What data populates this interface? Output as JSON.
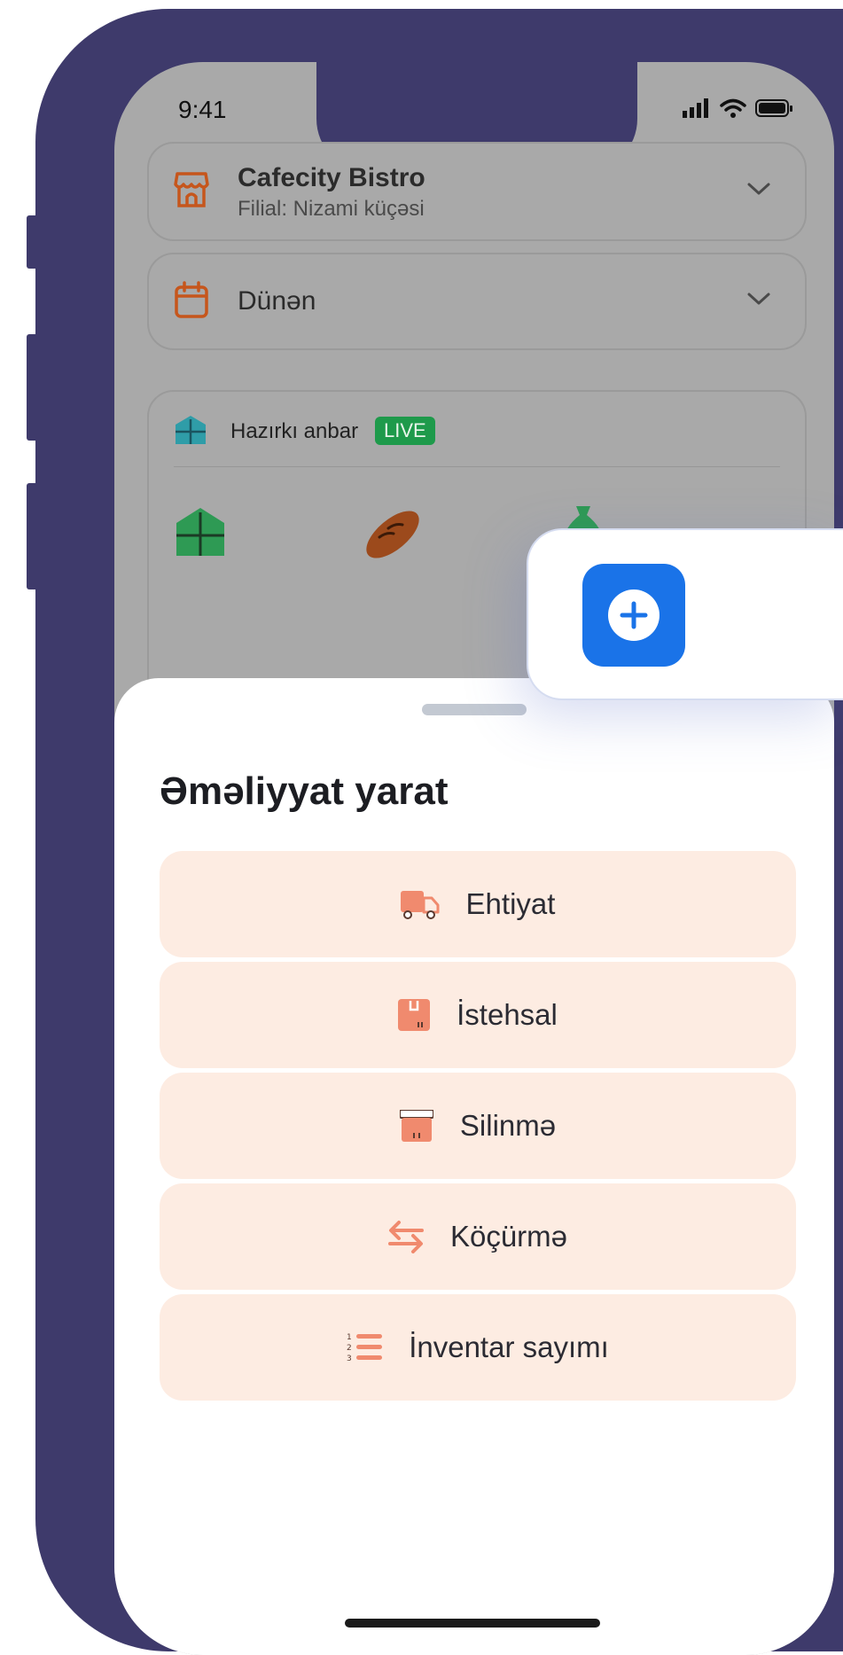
{
  "status_bar": {
    "time": "9:41"
  },
  "restaurant_selector": {
    "name": "Cafecity Bistro",
    "branch": "Filial: Nizami küçəsi"
  },
  "date_selector": {
    "label": "Dünən"
  },
  "inventory_card": {
    "label": "Hazırkı anbar",
    "badge": "LIVE"
  },
  "sheet": {
    "title": "Əməliyyat yarat",
    "actions": [
      {
        "label": "Ehtiyat",
        "icon": "delivery-truck-icon"
      },
      {
        "label": "İstehsal",
        "icon": "package-box-icon"
      },
      {
        "label": "Silinmə",
        "icon": "archive-box-icon"
      },
      {
        "label": "Köçürmə",
        "icon": "transfer-arrows-icon"
      },
      {
        "label": "İnventar sayımı",
        "icon": "numbered-list-icon"
      }
    ]
  },
  "fab": {
    "icon": "plus-circle-icon"
  },
  "colors": {
    "frame": "#3e3a6b",
    "accent_orange": "#d2691e",
    "action_bg": "#fdece2",
    "fab_blue": "#1a73e8",
    "live_green": "#1e9a4b"
  }
}
